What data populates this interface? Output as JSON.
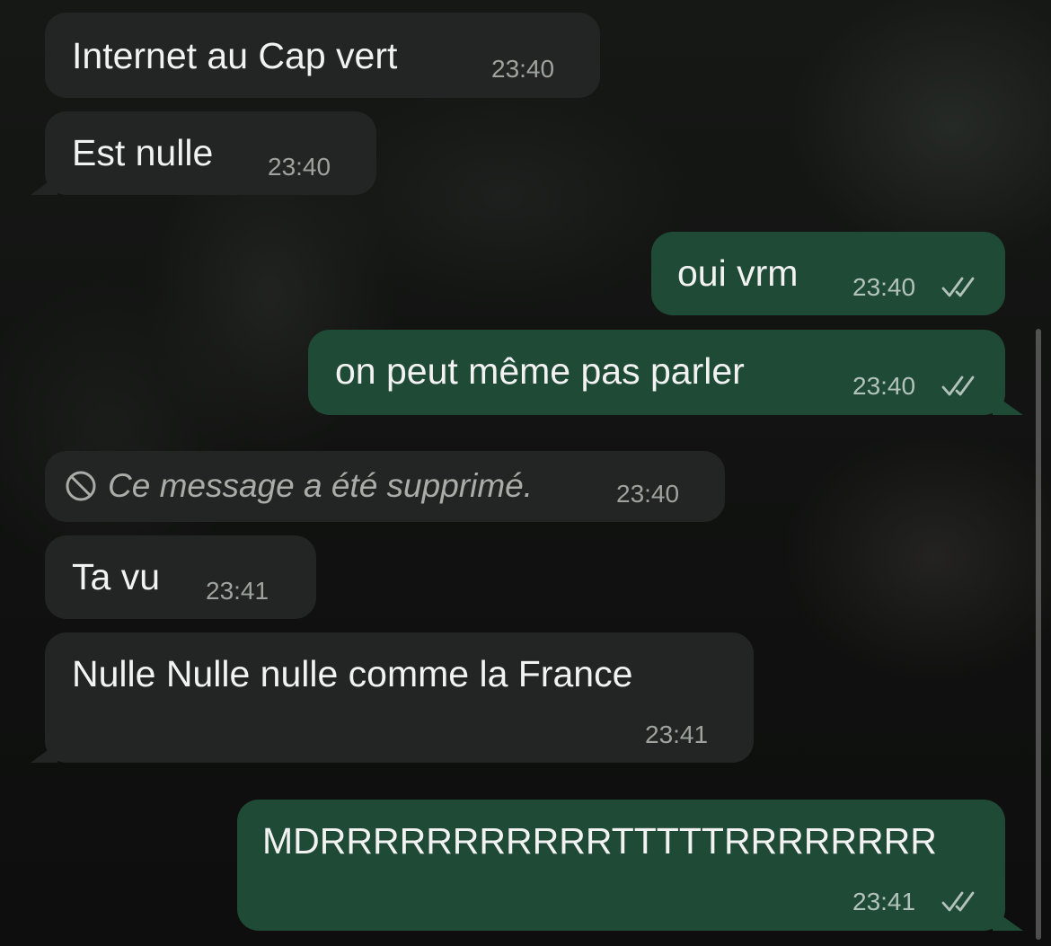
{
  "messages": [
    {
      "dir": "in",
      "text": "Internet au Cap vert",
      "time": "23:40"
    },
    {
      "dir": "in",
      "text": "Est nulle",
      "time": "23:40"
    },
    {
      "dir": "out",
      "text": "oui vrm",
      "time": "23:40",
      "status": "read"
    },
    {
      "dir": "out",
      "text": "on peut même pas parler",
      "time": "23:40",
      "status": "read"
    },
    {
      "dir": "in",
      "text": "Ce message a été supprimé.",
      "time": "23:40",
      "deleted": true
    },
    {
      "dir": "in",
      "text": "Ta vu",
      "time": "23:41"
    },
    {
      "dir": "in",
      "text": "Nulle Nulle nulle comme la France",
      "time": "23:41"
    },
    {
      "dir": "out",
      "text": "MDRRRRRRRRRRRTTTTTRRRRRRRR",
      "time": "23:41",
      "status": "read"
    }
  ],
  "icons": {
    "deleted": "ban-icon",
    "read_status": "double-check-icon"
  },
  "colors": {
    "incoming_bubble": "#232524",
    "outgoing_bubble": "#1f4a36",
    "timestamp": "#9ea39f"
  }
}
